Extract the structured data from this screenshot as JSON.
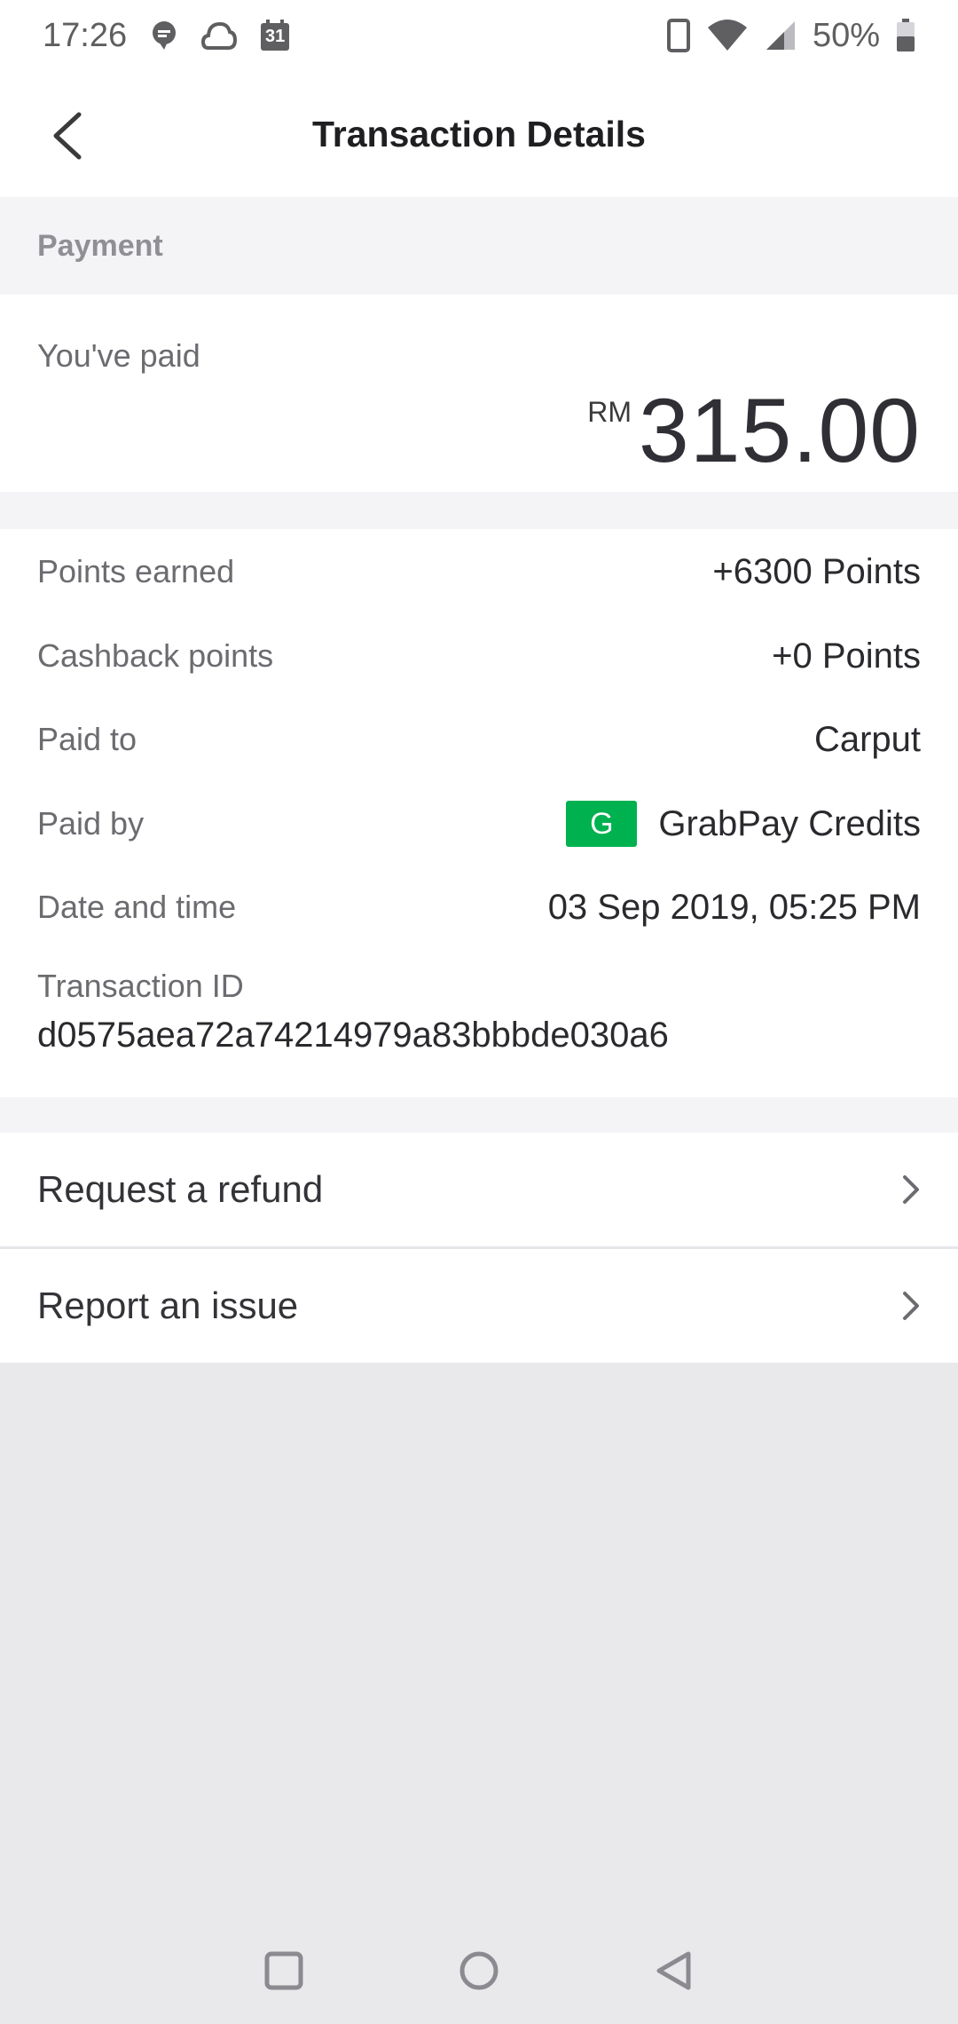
{
  "status_bar": {
    "time": "17:26",
    "battery_percent": "50%",
    "left_icons": [
      "chat-bubble-icon",
      "cloud-icon",
      "calendar-icon"
    ],
    "calendar_day": "31",
    "right_icons": [
      "phone-vibrate-icon",
      "wifi-icon",
      "cell-signal-icon",
      "battery-icon"
    ]
  },
  "header": {
    "title": "Transaction Details",
    "back_icon": "chevron-left-icon"
  },
  "payment": {
    "section_title": "Payment",
    "paid_label": "You've paid",
    "currency": "RM",
    "amount": "315.00"
  },
  "details": {
    "rows": [
      {
        "label": "Points earned",
        "value": "+6300 Points"
      },
      {
        "label": "Cashback points",
        "value": "+0 Points"
      },
      {
        "label": "Paid to",
        "value": "Carput"
      },
      {
        "label": "Paid by",
        "value": "GrabPay Credits",
        "icon": "grabpay-icon",
        "icon_letter": "G"
      },
      {
        "label": "Date and time",
        "value": "03 Sep 2019, 05:25 PM"
      }
    ],
    "transaction_id_label": "Transaction ID",
    "transaction_id": "d0575aea72a74214979a83bbbde030a6"
  },
  "actions": [
    {
      "label": "Request a refund",
      "icon": "chevron-right-icon"
    },
    {
      "label": "Report an issue",
      "icon": "chevron-right-icon"
    }
  ],
  "nav_bar": {
    "buttons": [
      "recents-square-icon",
      "home-circle-icon",
      "back-triangle-icon"
    ]
  },
  "colors": {
    "grab_green": "#00b14f",
    "page_background": "#e9e9ec",
    "section_background": "#f4f4f6"
  }
}
